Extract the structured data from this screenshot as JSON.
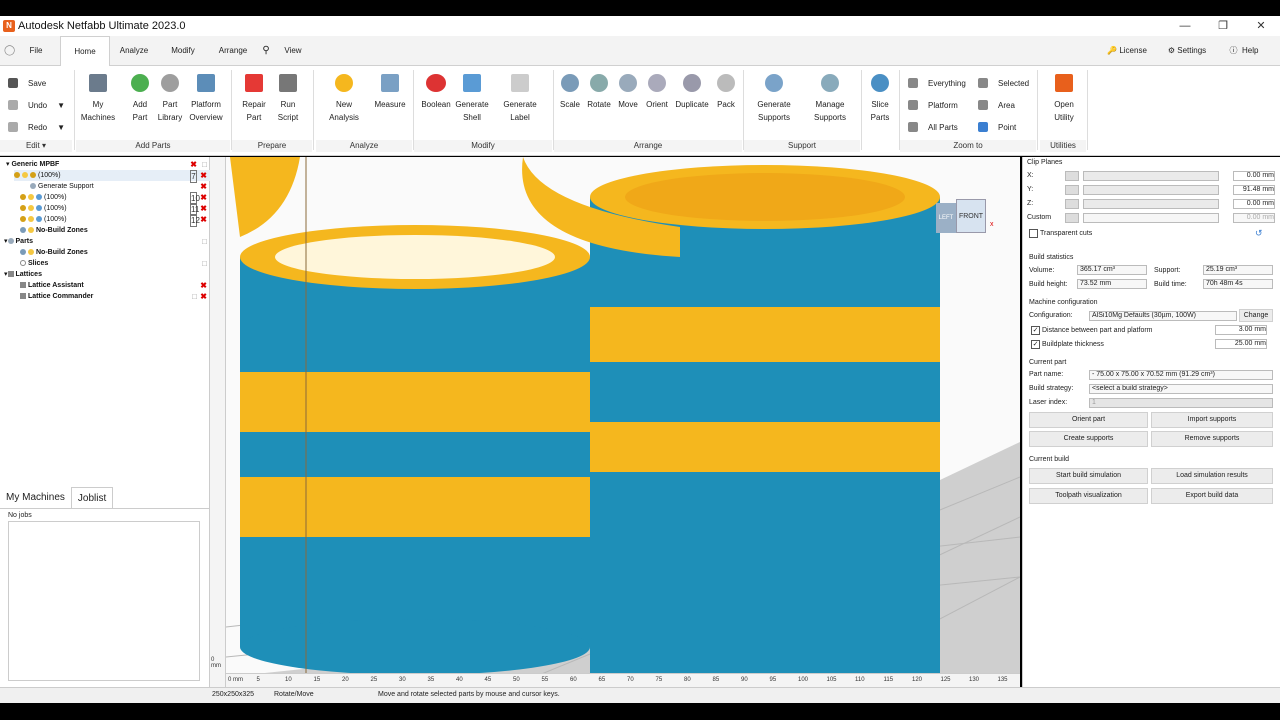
{
  "window": {
    "title": "Autodesk Netfabb Ultimate 2023.0",
    "app_icon_letter": "N"
  },
  "tabs": [
    "File",
    "Home",
    "Analyze",
    "Modify",
    "Arrange",
    "View"
  ],
  "right_menu": [
    "License",
    "Settings",
    "Help"
  ],
  "ribbon": {
    "edit": {
      "save": "Save",
      "undo": "Undo",
      "redo": "Redo",
      "group": "Edit"
    },
    "add_parts": {
      "buttons": [
        "My\nMachines",
        "Add\nPart",
        "Part\nLibrary",
        "Platform\nOverview"
      ],
      "group": "Add Parts"
    },
    "prepare": {
      "buttons": [
        "Repair\nPart",
        "Run\nScript"
      ],
      "group": "Prepare"
    },
    "analyze": {
      "buttons": [
        "New\nAnalysis",
        "Measure"
      ],
      "group": "Analyze"
    },
    "modify": {
      "buttons": [
        "Boolean",
        "Generate\nShell",
        "Generate\nLabel"
      ],
      "group": "Modify"
    },
    "arrange": {
      "buttons": [
        "Scale",
        "Rotate",
        "Move",
        "Orient",
        "Duplicate",
        "Pack"
      ],
      "group": "Arrange"
    },
    "support": {
      "buttons": [
        "Generate\nSupports",
        "Manage\nSupports"
      ],
      "group": "Support"
    },
    "slice": {
      "buttons": [
        "Slice\nParts"
      ]
    },
    "zoom": {
      "items": [
        "Everything",
        "Platform",
        "All Parts",
        "Selected",
        "Area",
        "Point"
      ],
      "group": "Zoom to"
    },
    "utilities": {
      "buttons": [
        "Open\nUtility"
      ],
      "group": "Utilities"
    }
  },
  "tree": {
    "root": "Generic MPBF",
    "rows": [
      "(100%)",
      "Generate Support",
      "(100%)",
      "(100%)",
      "(100%)",
      "No-Build Zones"
    ],
    "badges": [
      "7",
      "10",
      "11",
      "12"
    ],
    "parts": "Parts",
    "parts_nobuild": "No-Build Zones",
    "slices": "Slices",
    "lattices": "Lattices",
    "lattice_assistant": "Lattice Assistant",
    "lattice_commander": "Lattice Commander"
  },
  "bottom_tabs": [
    "My Machines",
    "Joblist"
  ],
  "joblist_text": "No jobs",
  "viewport": {
    "cube_left": "LEFT",
    "cube_front": "FRONT",
    "axis_x": "x",
    "ruler_h": [
      "0 mm",
      "5",
      "10",
      "15",
      "20",
      "25",
      "30",
      "35",
      "40",
      "45",
      "50",
      "55",
      "60",
      "65",
      "70",
      "75",
      "80",
      "85",
      "90",
      "95",
      "100",
      "105",
      "110",
      "115",
      "120",
      "125",
      "130",
      "135"
    ],
    "ruler_v_unit": "0 mm"
  },
  "right_panel": {
    "clip_planes": "Clip Planes",
    "axes": [
      "X:",
      "Y:",
      "Z:",
      "Custom"
    ],
    "clip_values": [
      "0.00 mm",
      "91.48 mm",
      "0.00 mm",
      "0.00 mm"
    ],
    "transparent_cuts": "Transparent cuts",
    "build_statistics": "Build statistics",
    "volume_label": "Volume:",
    "volume": "365.17 cm³",
    "support_label": "Support:",
    "support": "25.19 cm³",
    "build_height_label": "Build height:",
    "build_height": "73.52 mm",
    "build_time_label": "Build time:",
    "build_time": "70h 48m 4s",
    "machine_configuration": "Machine configuration",
    "configuration_label": "Configuration:",
    "configuration": "AlSi10Mg Defaults (30µm, 100W)",
    "change": "Change",
    "distance_label": "Distance between part and platform",
    "distance": "3.00 mm",
    "buildplate_label": "Buildplate thickness",
    "buildplate": "25.00 mm",
    "current_part": "Current part",
    "part_name_label": "Part name:",
    "part_name": "- 75.00 x 75.00 x 70.52 mm (91.29 cm³)",
    "build_strategy_label": "Build strategy:",
    "build_strategy": "<select a build strategy>",
    "laser_index_label": "Laser index:",
    "laser_index": "1",
    "orient_part": "Orient part",
    "import_supports": "Import supports",
    "create_supports": "Create supports",
    "remove_supports": "Remove supports",
    "current_build": "Current build",
    "start_build_simulation": "Start build simulation",
    "load_simulation_results": "Load simulation results",
    "toolpath_visualization": "Toolpath visualization",
    "export_build_data": "Export build data"
  },
  "status": {
    "platform": "250x250x325",
    "mode": "Rotate/Move",
    "hint": "Move and rotate selected parts by mouse and cursor keys."
  },
  "colors": {
    "gold": "#f5b71e",
    "lattice": "#1e8fb8",
    "accent": "#e8601c"
  }
}
